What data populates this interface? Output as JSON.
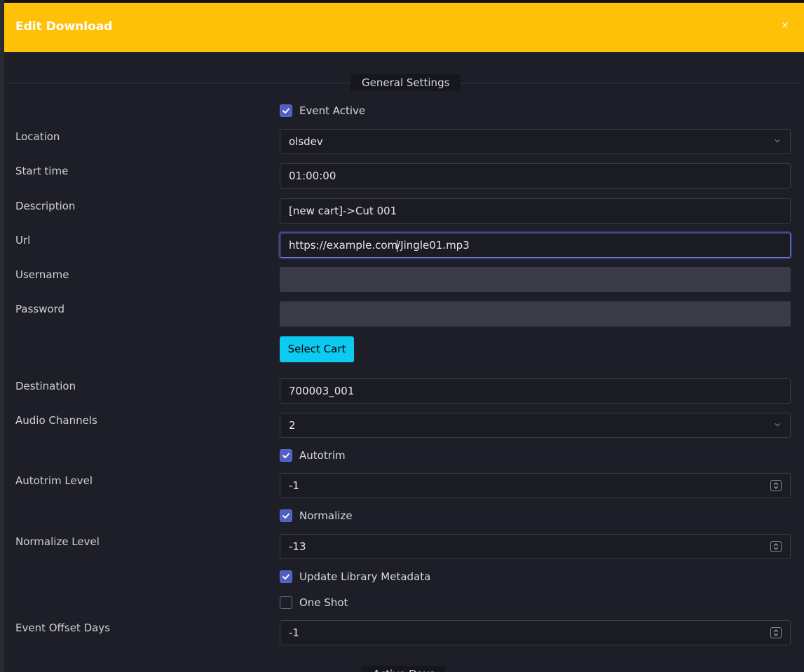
{
  "modal": {
    "title": "Edit Download",
    "close_label": "×"
  },
  "sections": {
    "general": "General Settings",
    "bottom_partial": "Active Days"
  },
  "form": {
    "event_active": {
      "label": "Event Active",
      "checked": true
    },
    "location": {
      "label": "Location",
      "value": "olsdev"
    },
    "start_time": {
      "label": "Start time",
      "value": "01:00:00"
    },
    "description": {
      "label": "Description",
      "value": "[new cart]->Cut 001"
    },
    "url": {
      "label": "Url",
      "value_before_caret": "https://example.com",
      "value_after_caret": "/Jingle01.mp3"
    },
    "username": {
      "label": "Username",
      "value": ""
    },
    "password": {
      "label": "Password",
      "value": ""
    },
    "select_cart": {
      "label": "Select Cart"
    },
    "destination": {
      "label": "Destination",
      "value": "700003_001"
    },
    "audio_channels": {
      "label": "Audio Channels",
      "value": "2"
    },
    "autotrim": {
      "label": "Autotrim",
      "checked": true
    },
    "autotrim_level": {
      "label": "Autotrim Level",
      "value": "-1"
    },
    "normalize": {
      "label": "Normalize",
      "checked": true
    },
    "normalize_level": {
      "label": "Normalize Level",
      "value": "-13"
    },
    "update_metadata": {
      "label": "Update Library Metadata",
      "checked": true
    },
    "one_shot": {
      "label": "One Shot",
      "checked": false
    },
    "event_offset_days": {
      "label": "Event Offset Days",
      "value": "-1"
    }
  },
  "colors": {
    "header": "#ffc107",
    "checkbox_on": "#4f5fc4",
    "button_info": "#0dcaf0",
    "modal_bg": "#1e1e28"
  },
  "icons": {
    "check": "check-icon",
    "chevron": "chevron-down-icon",
    "spinner": "spinner-arrows-icon",
    "close": "close-icon"
  }
}
